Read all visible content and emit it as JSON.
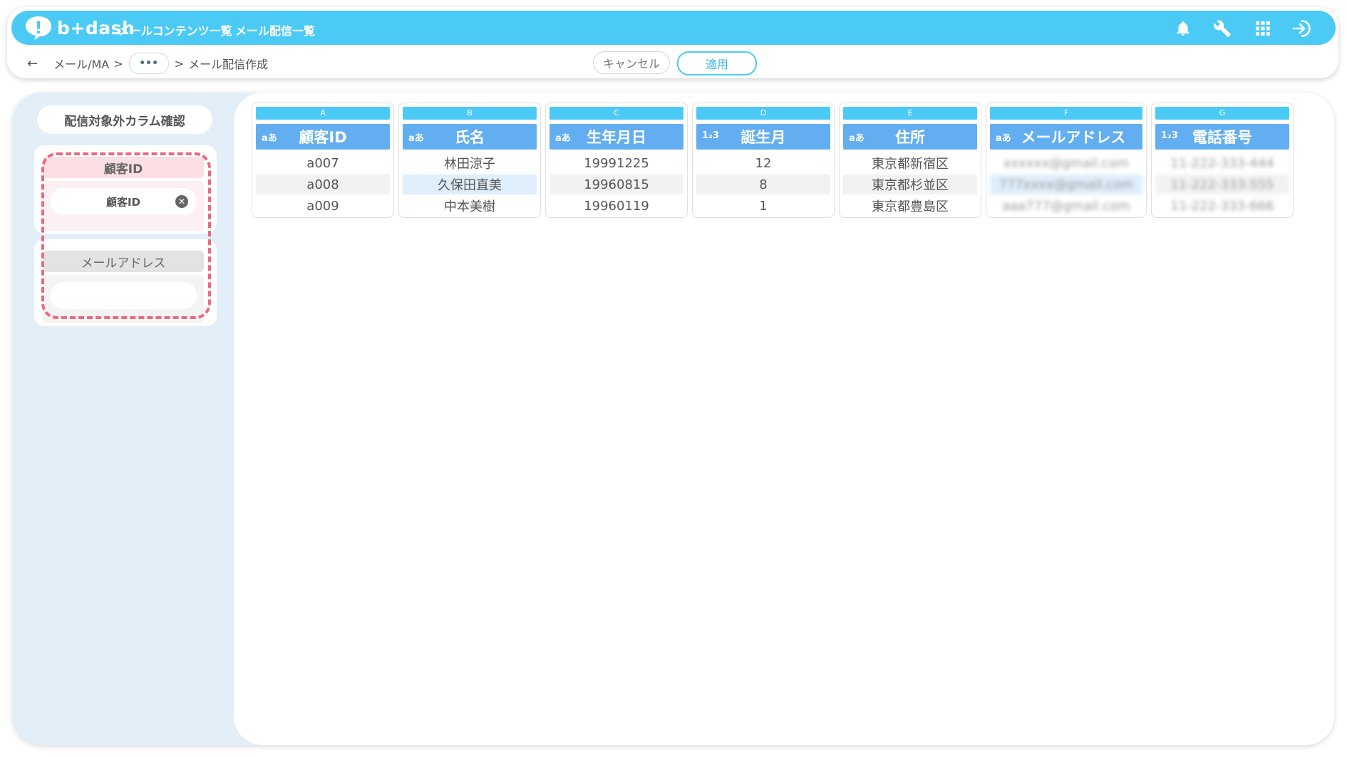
{
  "header": {
    "logo_text": "b+dash",
    "nav": [
      "メールコンテンツ一覧",
      "メール配信一覧"
    ],
    "icons": [
      "bell-icon",
      "wrench-icon",
      "apps-grid-icon",
      "logout-icon"
    ],
    "accent_color": "#4ccaf6"
  },
  "breadcrumb": {
    "back": "←",
    "root": "メール/MA",
    "sep1": ">",
    "ellipsis": "•••",
    "sep2": ">",
    "current": "メール配信作成"
  },
  "actions": {
    "cancel": "キャンセル",
    "apply": "適用"
  },
  "sidebar": {
    "title": "配信対象外カラム確認",
    "fields": [
      {
        "label": "顧客ID",
        "chip": "顧客ID",
        "chip_close": "✕"
      },
      {
        "label": "メールアドレス",
        "chip": ""
      }
    ]
  },
  "columns": [
    {
      "letter": "A",
      "type": "aあ",
      "name": "顧客ID",
      "cells": [
        "a007",
        "a008",
        "a009"
      ]
    },
    {
      "letter": "B",
      "type": "aあ",
      "name": "氏名",
      "cells": [
        "林田涼子",
        "久保田直美",
        "中本美樹"
      ]
    },
    {
      "letter": "C",
      "type": "aあ",
      "name": "生年月日",
      "cells": [
        "19991225",
        "19960815",
        "19960119"
      ]
    },
    {
      "letter": "D",
      "type": "1₂3",
      "name": "誕生月",
      "cells": [
        "12",
        "8",
        "1"
      ]
    },
    {
      "letter": "E",
      "type": "aあ",
      "name": "住所",
      "cells": [
        "東京都新宿区",
        "東京都杉並区",
        "東京都豊島区"
      ]
    },
    {
      "letter": "F",
      "type": "aあ",
      "name": "メールアドレス",
      "cells": [
        "xxxxxx@gmail.com",
        "777xxxx@gmail.com",
        "aaa777@gmail.com"
      ]
    },
    {
      "letter": "G",
      "type": "1₂3",
      "name": "電話番号",
      "cells": [
        "11-222-333-444",
        "11-222-333-555",
        "11-222-333-666"
      ]
    }
  ]
}
